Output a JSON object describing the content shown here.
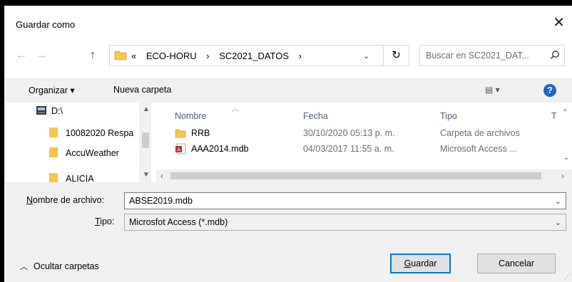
{
  "window": {
    "title": "Guardar como",
    "close_glyph": "✕"
  },
  "nav": {
    "back_glyph": "←",
    "forward_glyph": "→",
    "up_glyph": "↑"
  },
  "address": {
    "overflow": "«",
    "crumbs": [
      "ECO-HORU",
      "SC2021_DATOS"
    ],
    "separator": "›",
    "dropdown_glyph": "⌄",
    "refresh_glyph": "↻"
  },
  "search": {
    "placeholder": "Buscar en SC2021_DAT...",
    "icon": "search-icon"
  },
  "toolbar": {
    "organize_label": "Organizar ▾",
    "new_folder_label": "Nueva carpeta",
    "view_glyph": "▤ ▾",
    "help_glyph": "?"
  },
  "nav_pane": {
    "items": [
      {
        "label": "D:\\",
        "icon": "drive-icon"
      },
      {
        "label": "10082020 Respa",
        "icon": "folder-icon"
      },
      {
        "label": "AccuWeather",
        "icon": "folder-icon"
      },
      {
        "label": "ALICIA",
        "icon": "folder-icon"
      }
    ]
  },
  "files": {
    "columns": [
      "Nombre",
      "Fecha",
      "Tipo",
      "T"
    ],
    "rows": [
      {
        "name": "RRB",
        "date": "30/10/2020 05:13 p. m.",
        "type": "Carpeta de archivos",
        "icon": "folder-icon"
      },
      {
        "name": "AAA2014.mdb",
        "date": "04/03/2017 11:55 a. m.",
        "type": "Microsoft Access ...",
        "icon": "access-file-icon"
      }
    ]
  },
  "form": {
    "filename_label_u": "N",
    "filename_label_rest": "ombre de archivo:",
    "filename_value": "ABSE2019.mdb",
    "type_label_u": "T",
    "type_label_rest": "ipo:",
    "type_value": "Microsfot Access (*.mdb)",
    "hide_folders_label": "Ocultar carpetas",
    "save_label_u": "G",
    "save_label_rest": "uardar",
    "cancel_label": "Cancelar"
  },
  "colors": {
    "accent": "#0078d7",
    "folder": "#f4c64a",
    "help": "#1b67c6",
    "header_text": "#4c607a"
  }
}
